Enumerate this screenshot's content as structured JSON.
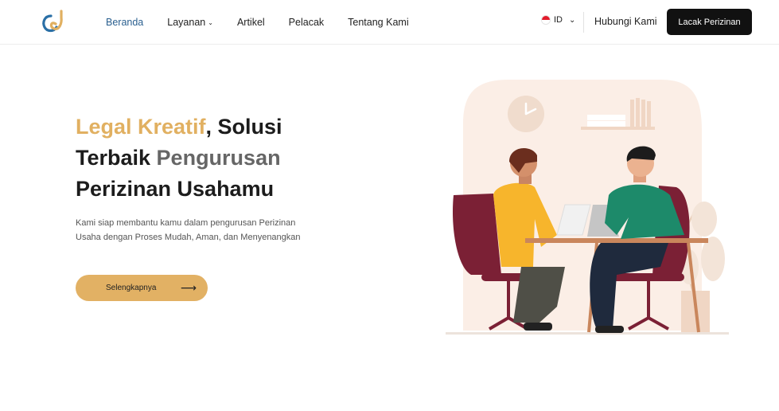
{
  "header": {
    "logo_icon": "ld-monogram-logo",
    "nav": [
      {
        "label": "Beranda",
        "active": true
      },
      {
        "label": "Layanan",
        "dropdown": true
      },
      {
        "label": "Artikel"
      },
      {
        "label": "Pelacak"
      },
      {
        "label": "Tentang Kami"
      }
    ],
    "language": {
      "code": "ID",
      "flag_icon": "indonesia-flag-icon"
    },
    "contact_label": "Hubungi Kami",
    "cta_label": "Lacak Perizinan"
  },
  "hero": {
    "title_part1": "Legal Kreatif",
    "title_part2": ", Solusi Terbaik ",
    "title_part3": "Pengurusan",
    "title_part4": " Perizinan Usahamu",
    "description": "Kami siap membantu kamu dalam pengurusan Perizinan Usaha dengan Proses Mudah, Aman, dan Menyenangkan",
    "button_label": "Selengkapnya",
    "button_icon": "arrow-right-icon"
  },
  "colors": {
    "accent_gold": "#e1b061",
    "nav_active": "#2a5f8f",
    "cta_bg": "#111111",
    "illustration_bg": "#fbeee6"
  }
}
